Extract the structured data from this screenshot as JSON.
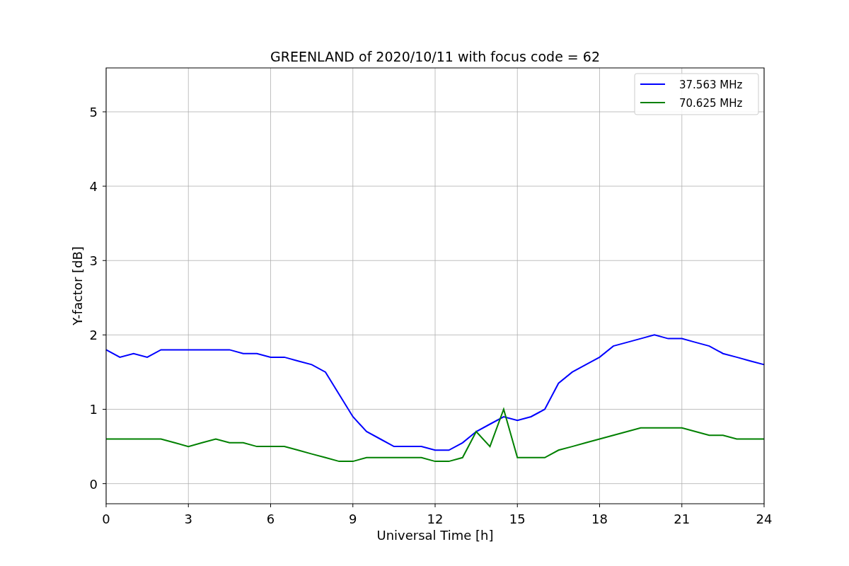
{
  "chart_data": {
    "type": "line",
    "title": "GREENLAND of 2020/10/11 with focus code = 62",
    "xlabel": "Universal Time [h]",
    "ylabel": "Y-factor [dB]",
    "x": [
      0,
      0.5,
      1,
      1.5,
      2,
      2.5,
      3,
      3.5,
      4,
      4.5,
      5,
      5.5,
      6,
      6.5,
      7,
      7.5,
      8,
      8.5,
      9,
      9.5,
      10,
      10.5,
      11,
      11.5,
      12,
      12.5,
      13,
      13.5,
      14,
      14.5,
      15,
      15.5,
      16,
      16.5,
      17,
      17.5,
      18,
      18.5,
      19,
      19.5,
      20,
      20.5,
      21,
      21.5,
      22,
      22.5,
      23,
      23.5,
      24
    ],
    "series": [
      {
        "name": "37.563 MHz",
        "color": "#0000ff",
        "values": [
          1.8,
          1.7,
          1.75,
          1.7,
          1.8,
          1.8,
          1.8,
          1.8,
          1.8,
          1.8,
          1.75,
          1.75,
          1.7,
          1.7,
          1.65,
          1.6,
          1.5,
          1.2,
          0.9,
          0.7,
          0.6,
          0.5,
          0.5,
          0.5,
          0.45,
          0.45,
          0.55,
          0.7,
          0.8,
          0.9,
          0.85,
          0.9,
          1.0,
          1.35,
          1.5,
          1.6,
          1.7,
          1.85,
          1.9,
          1.95,
          2.0,
          1.95,
          1.95,
          1.9,
          1.85,
          1.75,
          1.7,
          1.65,
          1.6
        ]
      },
      {
        "name": "70.625 MHz",
        "color": "#008000",
        "values": [
          0.6,
          0.6,
          0.6,
          0.6,
          0.6,
          0.55,
          0.5,
          0.55,
          0.6,
          0.55,
          0.55,
          0.5,
          0.5,
          0.5,
          0.45,
          0.4,
          0.35,
          0.3,
          0.3,
          0.35,
          0.35,
          0.35,
          0.35,
          0.35,
          0.3,
          0.3,
          0.35,
          0.7,
          0.5,
          1.0,
          0.35,
          0.35,
          0.35,
          0.45,
          0.5,
          0.55,
          0.6,
          0.65,
          0.7,
          0.75,
          0.75,
          0.75,
          0.75,
          0.7,
          0.65,
          0.65,
          0.6,
          0.6,
          0.6
        ]
      }
    ],
    "xlim": [
      0,
      24
    ],
    "ylim": [
      -0.27,
      5.59
    ],
    "xticks": [
      0,
      3,
      6,
      9,
      12,
      15,
      18,
      21,
      24
    ],
    "yticks": [
      0,
      1,
      2,
      3,
      4,
      5
    ],
    "grid": true,
    "legend": true
  }
}
